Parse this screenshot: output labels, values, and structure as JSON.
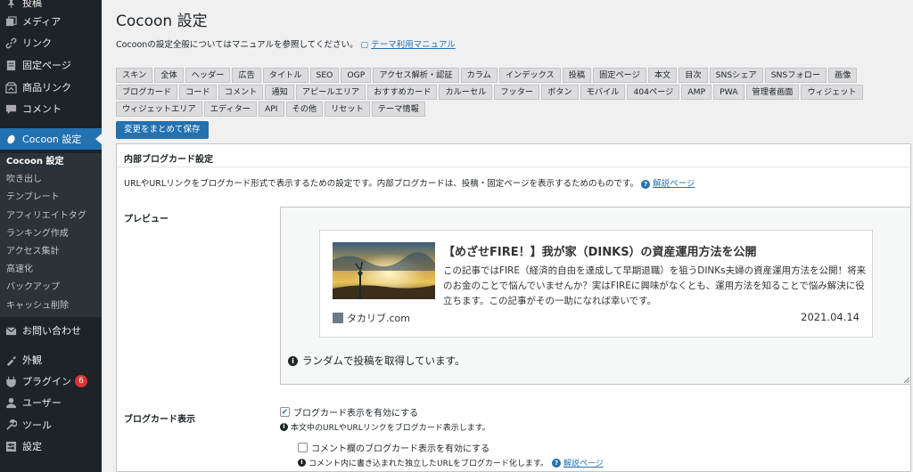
{
  "sidebar": {
    "items_top": [
      {
        "label": "投稿",
        "icon": "pin-icon"
      },
      {
        "label": "メディア",
        "icon": "media-icon"
      },
      {
        "label": "リンク",
        "icon": "link-icon"
      },
      {
        "label": "固定ページ",
        "icon": "page-icon"
      },
      {
        "label": "商品リンク",
        "icon": "product-link-icon"
      },
      {
        "label": "コメント",
        "icon": "comment-icon"
      }
    ],
    "active": {
      "label": "Cocoon 設定",
      "icon": "cocoon-icon"
    },
    "submenu": [
      "Cocoon 設定",
      "吹き出し",
      "テンプレート",
      "アフィリエイトタグ",
      "ランキング作成",
      "アクセス集計",
      "高速化",
      "バックアップ",
      "キャッシュ削除"
    ],
    "items_bottom": [
      {
        "label": "お問い合わせ",
        "icon": "mail-icon"
      },
      {
        "label": "外観",
        "icon": "appearance-icon"
      },
      {
        "label": "プラグイン",
        "icon": "plugin-icon",
        "badge": "6"
      },
      {
        "label": "ユーザー",
        "icon": "user-icon"
      },
      {
        "label": "ツール",
        "icon": "tool-icon"
      },
      {
        "label": "設定",
        "icon": "settings-icon"
      }
    ]
  },
  "page": {
    "title": "Cocoon 設定",
    "intro": "Cocoonの設定全般についてはマニュアルを参照してください。",
    "manual_link": "テーマ利用マニュアル"
  },
  "tabs": [
    "スキン",
    "全体",
    "ヘッダー",
    "広告",
    "タイトル",
    "SEO",
    "OGP",
    "アクセス解析・認証",
    "カラム",
    "インデックス",
    "投稿",
    "固定ページ",
    "本文",
    "目次",
    "SNSシェア",
    "SNSフォロー",
    "画像",
    "ブログカード",
    "コード",
    "コメント",
    "通知",
    "アピールエリア",
    "おすすめカード",
    "カルーセル",
    "フッター",
    "ボタン",
    "モバイル",
    "404ページ",
    "AMP",
    "PWA",
    "管理者画面",
    "ウィジェット",
    "ウィジェットエリア",
    "エディター",
    "API",
    "その他",
    "リセット",
    "テーマ情報"
  ],
  "save_button": "変更をまとめて保存",
  "panel": {
    "title": "内部ブログカード設定",
    "description": "URLやURLリンクをブログカード形式で表示するための設定です。内部ブログカードは、投稿・固定ページを表示するためのものです。",
    "help_link": "解説ページ",
    "preview_label": "プレビュー",
    "card": {
      "title": "【めざせFIRE！】我が家（DINKS）の資産運用方法を公開",
      "excerpt": "この記事ではFIRE（経済的自由を達成して早期退職）を狙うDINKs夫婦の資産運用方法を公開！将来のお金のことで悩んでいませんか？実はFIREに興味がなくとも、運用方法を知ることで悩み解決に役立ちます。この記事がその一助になれば幸いです。",
      "site": "タカリブ.com",
      "date": "2021.04.14"
    },
    "random_note": "ランダムで投稿を取得しています。",
    "blogcard_label": "ブログカード表示",
    "option1": "ブログカード表示を有効にする",
    "option1_note": "本文中のURLやURLリンクをブログカード表示します。",
    "option2": "コメント欄のブログカード表示を有効にする",
    "option2_note": "コメント内に書き込まれた独立したURLをブログカード化します。",
    "option2_help": "解説ページ"
  }
}
